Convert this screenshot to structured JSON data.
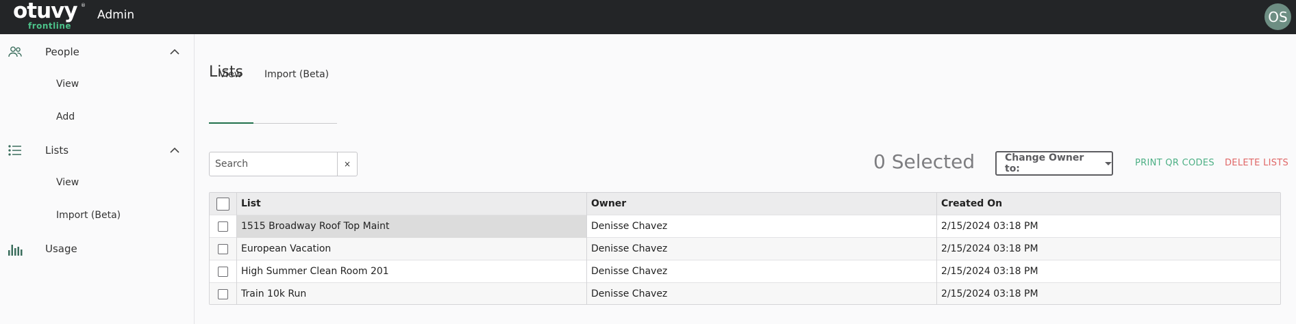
{
  "topbar": {
    "logo_text": "otuvy",
    "logo_tm": "®",
    "logo_sub": "frontline",
    "app_title": "Admin",
    "avatar_initials": "OS"
  },
  "sidebar": {
    "items": [
      {
        "label": "People",
        "icon": "people-icon",
        "expanded": true,
        "children": [
          {
            "label": "View"
          },
          {
            "label": "Add"
          }
        ]
      },
      {
        "label": "Lists",
        "icon": "list-icon",
        "expanded": true,
        "children": [
          {
            "label": "View"
          },
          {
            "label": "Import (Beta)"
          }
        ]
      },
      {
        "label": "Usage",
        "icon": "bar-chart-icon"
      }
    ]
  },
  "main": {
    "title": "Lists",
    "tabs": [
      {
        "label": "View",
        "active": true
      },
      {
        "label": "Import (Beta)",
        "active": false
      }
    ],
    "search": {
      "placeholder": "Search",
      "value": "",
      "clear_label": "×"
    },
    "selected_count": "0 Selected",
    "change_owner_label": "Change Owner to:",
    "print_label": "PRINT QR CODES",
    "delete_label": "DELETE LISTS",
    "colors": {
      "accent_green": "#1f6f4a",
      "print": "#4caf84",
      "delete": "#e06666"
    }
  },
  "table": {
    "columns": [
      "List",
      "Owner",
      "Created On"
    ],
    "rows": [
      {
        "list": "1515 Broadway Roof Top Maint",
        "owner": "Denisse Chavez",
        "created": "2/15/2024 03:18 PM"
      },
      {
        "list": "European Vacation",
        "owner": "Denisse Chavez",
        "created": "2/15/2024 03:18 PM"
      },
      {
        "list": "High Summer Clean Room 201",
        "owner": "Denisse Chavez",
        "created": "2/15/2024 03:18 PM"
      },
      {
        "list": "Train 10k Run",
        "owner": "Denisse Chavez",
        "created": "2/15/2024 03:18 PM"
      }
    ]
  }
}
